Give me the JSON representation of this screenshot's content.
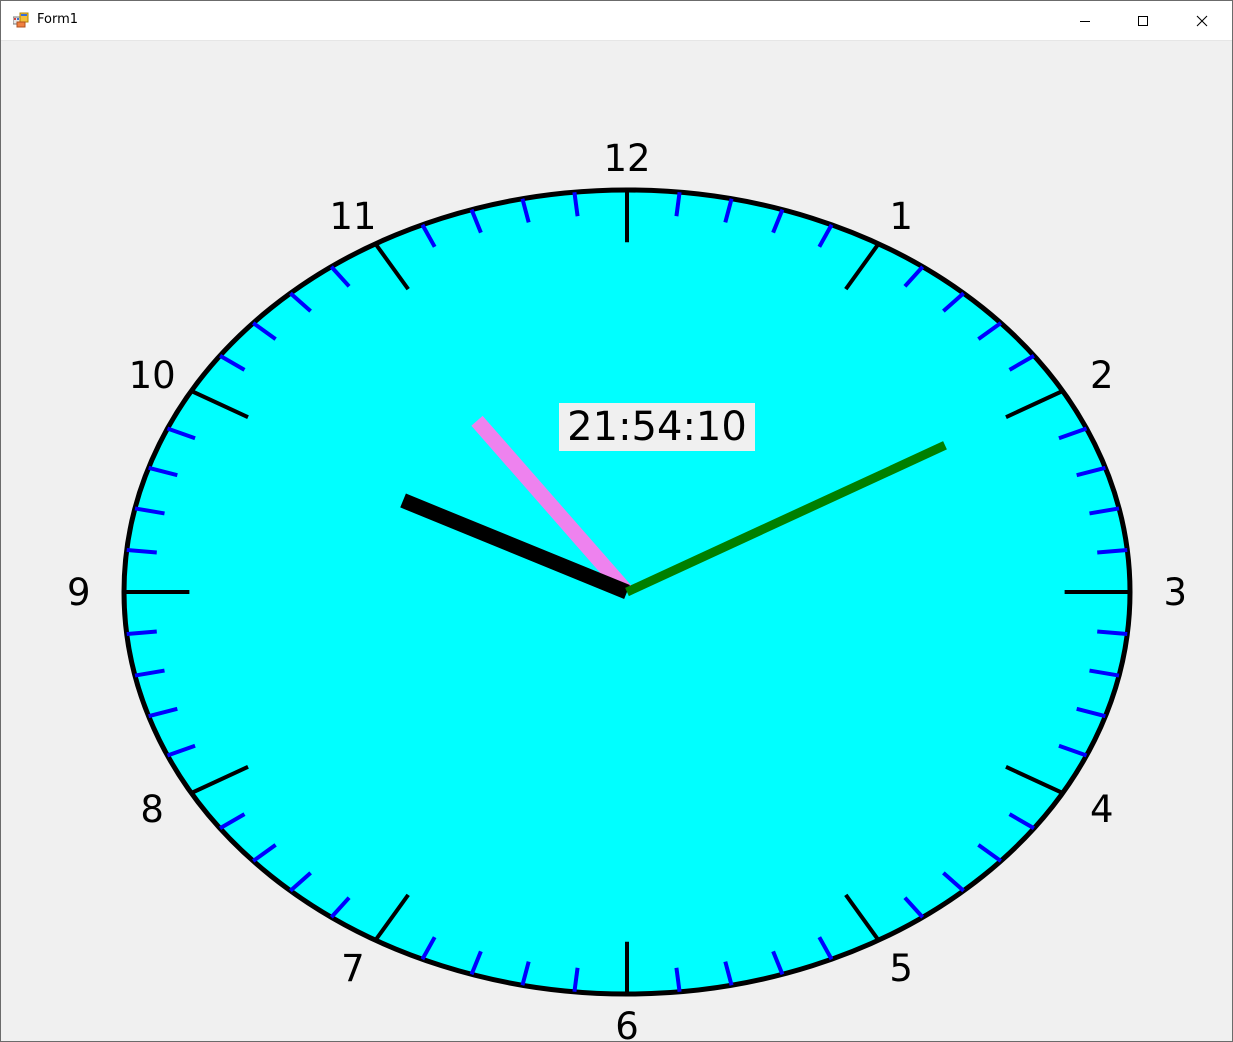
{
  "window": {
    "title": "Form1",
    "icons": {
      "app": "winforms-app-icon",
      "minimize": "minimize-icon",
      "maximize": "maximize-icon",
      "close": "close-icon"
    }
  },
  "clock": {
    "digital_time": "21:54:10",
    "hours": 21,
    "minutes": 54,
    "seconds": 10,
    "numerals": [
      "12",
      "1",
      "2",
      "3",
      "4",
      "5",
      "6",
      "7",
      "8",
      "9",
      "10",
      "11"
    ],
    "colors": {
      "face": "#00ffff",
      "rim": "#000000",
      "hour_ticks": "#000000",
      "minute_ticks": "#0000ff",
      "hour_hand": "#000000",
      "minute_hand": "#ee82ee",
      "second_hand": "#008000",
      "numerals": "#000000"
    }
  }
}
